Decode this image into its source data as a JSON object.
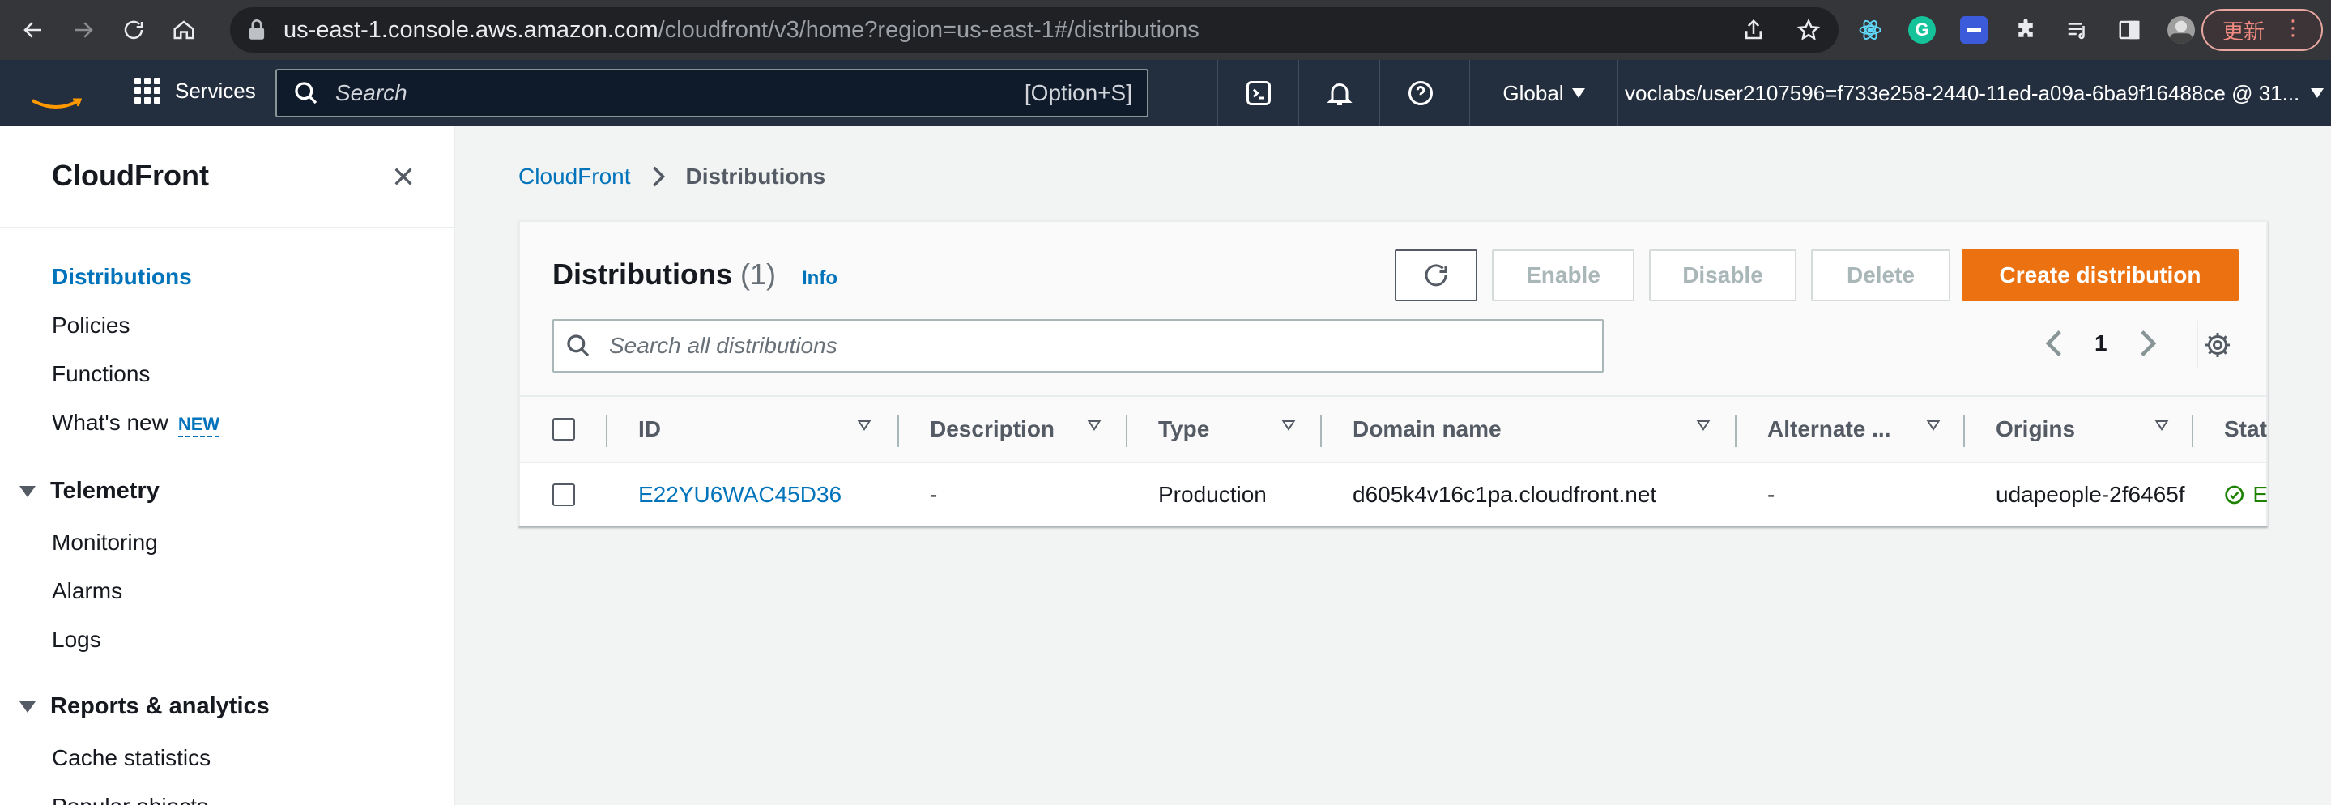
{
  "browser": {
    "url_host": "us-east-1.console.aws.amazon.com",
    "url_path": "/cloudfront/v3/home?region=us-east-1#/distributions",
    "update_label": "更新"
  },
  "topnav": {
    "services_label": "Services",
    "search_placeholder": "Search",
    "search_shortcut": "[Option+S]",
    "region_label": "Global",
    "account_label": "voclabs/user2107596=f733e258-2440-11ed-a09a-6ba9f16488ce @ 31..."
  },
  "sidebar": {
    "title": "CloudFront",
    "items": [
      {
        "label": "Distributions"
      },
      {
        "label": "Policies"
      },
      {
        "label": "Functions"
      },
      {
        "label": "What's new",
        "badge": "NEW"
      }
    ],
    "sections": [
      {
        "label": "Telemetry",
        "items": [
          "Monitoring",
          "Alarms",
          "Logs"
        ]
      },
      {
        "label": "Reports & analytics",
        "items": [
          "Cache statistics",
          "Popular objects"
        ]
      }
    ]
  },
  "breadcrumb": {
    "root": "CloudFront",
    "current": "Distributions"
  },
  "panel": {
    "title": "Distributions",
    "count": "(1)",
    "info": "Info",
    "buttons": {
      "enable": "Enable",
      "disable": "Disable",
      "delete": "Delete",
      "create": "Create distribution"
    },
    "search_placeholder": "Search all distributions",
    "page_number": "1"
  },
  "table": {
    "columns": [
      "ID",
      "Description",
      "Type",
      "Domain name",
      "Alternate ...",
      "Origins",
      "Statu"
    ],
    "rows": [
      {
        "id": "E22YU6WAC45D36",
        "description": "-",
        "type": "Production",
        "domain": "d605k4v16c1pa.cloudfront.net",
        "alternate": "-",
        "origins": "udapeople-2f6465f",
        "status": "E"
      }
    ]
  },
  "colors": {
    "link": "#0073bb",
    "primary_button": "#ec7211",
    "aws_nav": "#232f3e",
    "status_ok": "#1d8102"
  }
}
